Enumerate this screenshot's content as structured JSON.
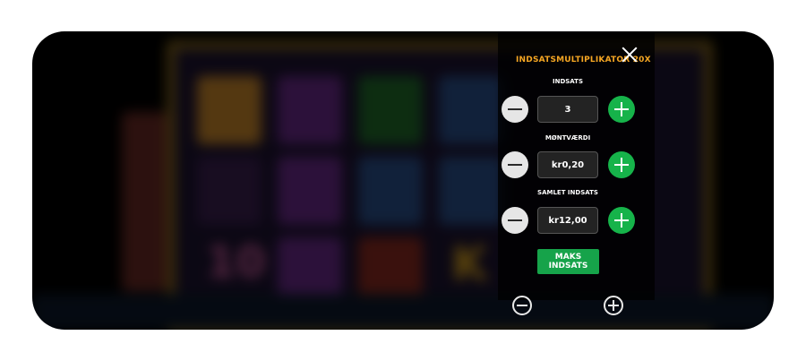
{
  "panel": {
    "title": "INDSATSMULTIPLIKATOR 20x",
    "max_label_line1": "MAKS",
    "max_label_line2": "INDSATS"
  },
  "controls": [
    {
      "label": "INDSATS",
      "value": "3"
    },
    {
      "label": "MØNTVÆRDI",
      "value": "kr0,20"
    },
    {
      "label": "SAMLET INDSATS",
      "value": "kr12,00"
    }
  ],
  "background": {
    "symbols": [
      "10",
      "K"
    ]
  },
  "colors": {
    "accent": "#f5a623",
    "plus_button": "#16b34a",
    "max_button": "#16a34a"
  },
  "icons": {
    "close": "close-icon",
    "minus": "minus-icon",
    "plus": "plus-icon"
  }
}
